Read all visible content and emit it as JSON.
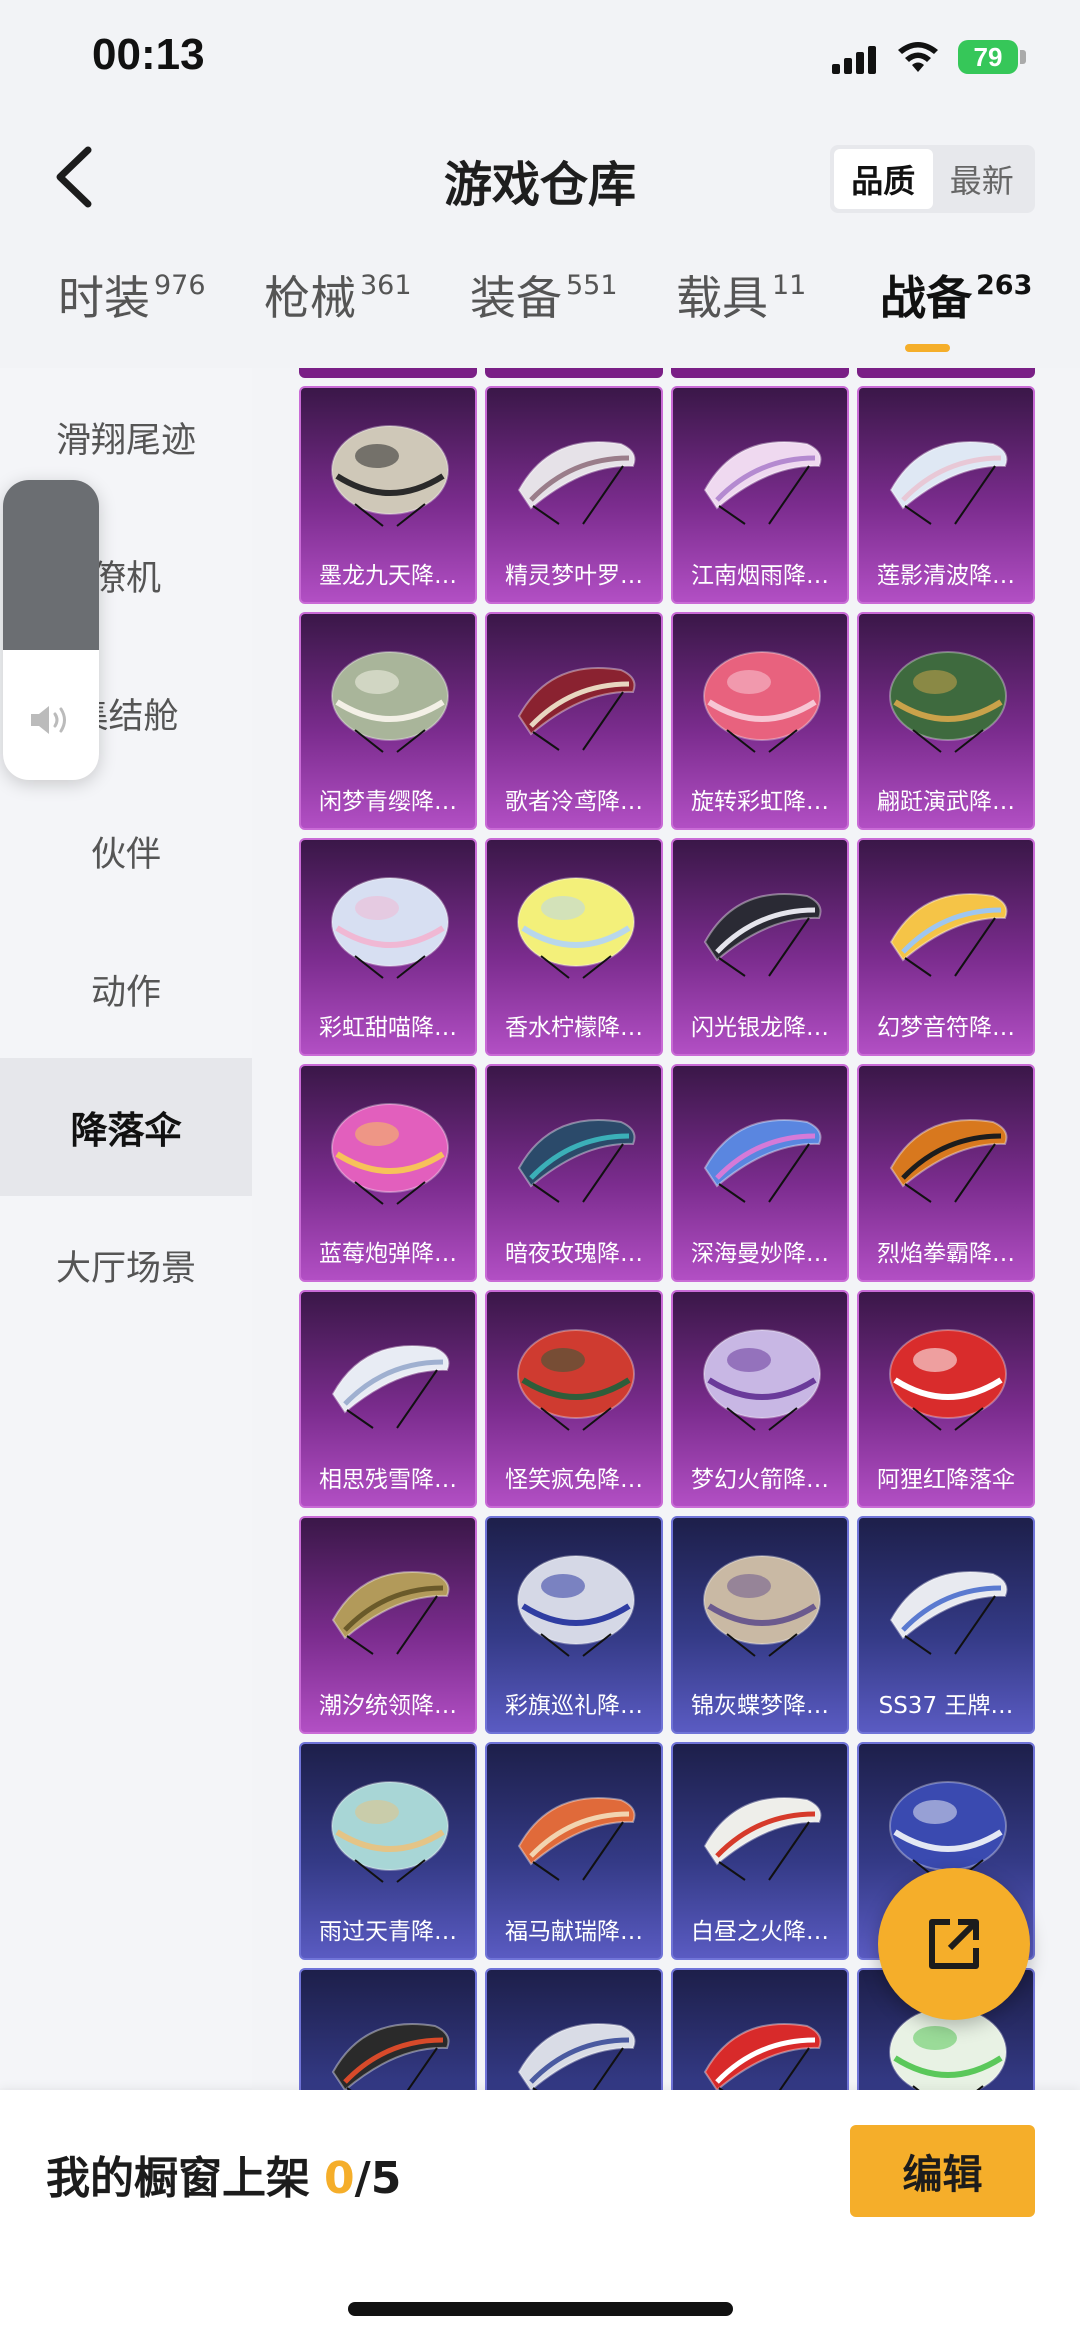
{
  "status": {
    "time": "00:13",
    "battery": "79"
  },
  "header": {
    "title": "游戏仓库",
    "sort": [
      "品质",
      "最新"
    ],
    "sort_active": 0
  },
  "tabs": [
    {
      "label": "时装",
      "count": "976"
    },
    {
      "label": "枪械",
      "count": "361"
    },
    {
      "label": "装备",
      "count": "551"
    },
    {
      "label": "载具",
      "count": "11"
    },
    {
      "label": "战备",
      "count": "263"
    }
  ],
  "sidebar": [
    {
      "label": "滑翔尾迹"
    },
    {
      "label": "僚机"
    },
    {
      "label": "集结舱"
    },
    {
      "label": "伙伴"
    },
    {
      "label": "动作"
    },
    {
      "label": "降落伞"
    },
    {
      "label": "大厅场景"
    }
  ],
  "items": [
    {
      "name": "墨龙九天降…",
      "tier": "purple",
      "color": "#cfc8b8",
      "accent": "#2a2a2a",
      "shape": "dome"
    },
    {
      "name": "精灵梦叶罗…",
      "tier": "purple",
      "color": "#e6e2e8",
      "accent": "#9a7d8a",
      "shape": "wing"
    },
    {
      "name": "江南烟雨降…",
      "tier": "purple",
      "color": "#efd9f0",
      "accent": "#b48ad0",
      "shape": "wing"
    },
    {
      "name": "莲影清波降…",
      "tier": "purple",
      "color": "#dfe8f4",
      "accent": "#e8c8d6",
      "shape": "wing"
    },
    {
      "name": "闲梦青缨降…",
      "tier": "purple",
      "color": "#a9b59a",
      "accent": "#f3f0e6",
      "shape": "dome"
    },
    {
      "name": "歌者泠鸢降…",
      "tier": "purple",
      "color": "#8a2230",
      "accent": "#e8d6c0",
      "shape": "wing"
    },
    {
      "name": "旋转彩虹降…",
      "tier": "purple",
      "color": "#e8627e",
      "accent": "#f7c6d4",
      "shape": "dome"
    },
    {
      "name": "翩跹演武降…",
      "tier": "purple",
      "color": "#3e6a3e",
      "accent": "#c9a24a",
      "shape": "dome"
    },
    {
      "name": "彩虹甜喵降…",
      "tier": "purple",
      "color": "#d7dff2",
      "accent": "#f0b8d4",
      "shape": "dome"
    },
    {
      "name": "香水柠檬降…",
      "tier": "purple",
      "color": "#f3f07a",
      "accent": "#b8d7ec",
      "shape": "dome"
    },
    {
      "name": "闪光银龙降…",
      "tier": "purple",
      "color": "#2a2a34",
      "accent": "#e4e4ec",
      "shape": "wing"
    },
    {
      "name": "幻梦音符降…",
      "tier": "purple",
      "color": "#f5c447",
      "accent": "#9ec6f0",
      "shape": "wing"
    },
    {
      "name": "蓝莓炮弹降…",
      "tier": "purple",
      "color": "#e25fbd",
      "accent": "#f7c25a",
      "shape": "dome"
    },
    {
      "name": "暗夜玫瑰降…",
      "tier": "purple",
      "color": "#2b4a6a",
      "accent": "#3bb0b8",
      "shape": "wing"
    },
    {
      "name": "深海曼妙降…",
      "tier": "purple",
      "color": "#5a86e0",
      "accent": "#d57ad8",
      "shape": "wing"
    },
    {
      "name": "烈焰拳霸降…",
      "tier": "purple",
      "color": "#d8781e",
      "accent": "#1d1d1d",
      "shape": "wing"
    },
    {
      "name": "相思残雪降…",
      "tier": "purple",
      "color": "#e8ecf4",
      "accent": "#9fb0d0",
      "shape": "wing"
    },
    {
      "name": "怪笑疯兔降…",
      "tier": "purple",
      "color": "#cf3b30",
      "accent": "#2f5d3a",
      "shape": "dome"
    },
    {
      "name": "梦幻火箭降…",
      "tier": "purple",
      "color": "#c8b7e4",
      "accent": "#6a3b9a",
      "shape": "dome"
    },
    {
      "name": "阿狸红降落伞",
      "tier": "purple",
      "color": "#d92c2c",
      "accent": "#ffffff",
      "shape": "dome"
    },
    {
      "name": "潮汐统领降…",
      "tier": "purple",
      "color": "#b29a5a",
      "accent": "#6a5a2a",
      "shape": "wing"
    },
    {
      "name": "彩旗巡礼降…",
      "tier": "blue",
      "color": "#d5d8e6",
      "accent": "#2f3da2",
      "shape": "dome"
    },
    {
      "name": "锦灰蝶梦降…",
      "tier": "blue",
      "color": "#c9b9a4",
      "accent": "#6b5a8e",
      "shape": "dome"
    },
    {
      "name": "SS37 王牌…",
      "tier": "blue",
      "color": "#e8eaf0",
      "accent": "#5a7ad0",
      "shape": "wing"
    },
    {
      "name": "雨过天青降…",
      "tier": "blue",
      "color": "#a8d6d6",
      "accent": "#e4c486",
      "shape": "dome"
    },
    {
      "name": "福马献瑞降…",
      "tier": "blue",
      "color": "#e06a3a",
      "accent": "#f2d4b0",
      "shape": "wing"
    },
    {
      "name": "白昼之火降…",
      "tier": "blue",
      "color": "#eeeeea",
      "accent": "#d63a2a",
      "shape": "wing"
    },
    {
      "name": "",
      "tier": "blue",
      "color": "#3a4ab0",
      "accent": "#e4e8f4",
      "shape": "dome"
    },
    {
      "name": "",
      "tier": "blue",
      "color": "#2a2a2a",
      "accent": "#d84a2a",
      "shape": "wing"
    },
    {
      "name": "",
      "tier": "blue",
      "color": "#d9dce6",
      "accent": "#4a5aa0",
      "shape": "wing"
    },
    {
      "name": "",
      "tier": "blue",
      "color": "#d82a2a",
      "accent": "#ffffff",
      "shape": "wing"
    },
    {
      "name": "",
      "tier": "blue",
      "color": "#e8f2e4",
      "accent": "#5ac85a",
      "shape": "dome"
    }
  ],
  "showcase": {
    "label": "我的橱窗上架",
    "current": "0",
    "total": "/5"
  },
  "edit_label": "编辑"
}
